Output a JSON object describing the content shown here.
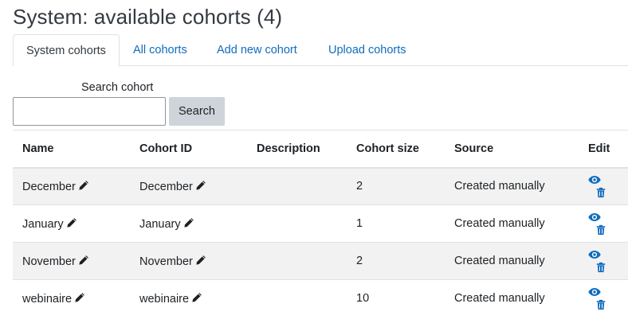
{
  "page": {
    "title": "System: available cohorts (4)"
  },
  "tabs": [
    {
      "label": "System cohorts",
      "active": true
    },
    {
      "label": "All cohorts",
      "active": false
    },
    {
      "label": "Add new cohort",
      "active": false
    },
    {
      "label": "Upload cohorts",
      "active": false
    }
  ],
  "search": {
    "label": "Search cohort",
    "value": "",
    "button_label": "Search"
  },
  "table": {
    "headers": {
      "name": "Name",
      "cohort_id": "Cohort ID",
      "description": "Description",
      "cohort_size": "Cohort size",
      "source": "Source",
      "edit": "Edit"
    },
    "rows": [
      {
        "name": "December",
        "cohort_id": "December",
        "description": "",
        "cohort_size": "2",
        "source": "Created manually"
      },
      {
        "name": "January",
        "cohort_id": "January",
        "description": "",
        "cohort_size": "1",
        "source": "Created manually"
      },
      {
        "name": "November",
        "cohort_id": "November",
        "description": "",
        "cohort_size": "2",
        "source": "Created manually"
      },
      {
        "name": "webinaire",
        "cohort_id": "webinaire",
        "description": "",
        "cohort_size": "10",
        "source": "Created manually"
      }
    ]
  },
  "icons": {
    "inline_edit": "pencil-icon",
    "hide": "eye-icon",
    "delete": "trash-icon"
  },
  "colors": {
    "link": "#0f6cbf",
    "icon_action": "#0f6cbf",
    "pencil": "#1d2125",
    "stripe": "#f2f2f2",
    "button_bg": "#ced4da"
  }
}
